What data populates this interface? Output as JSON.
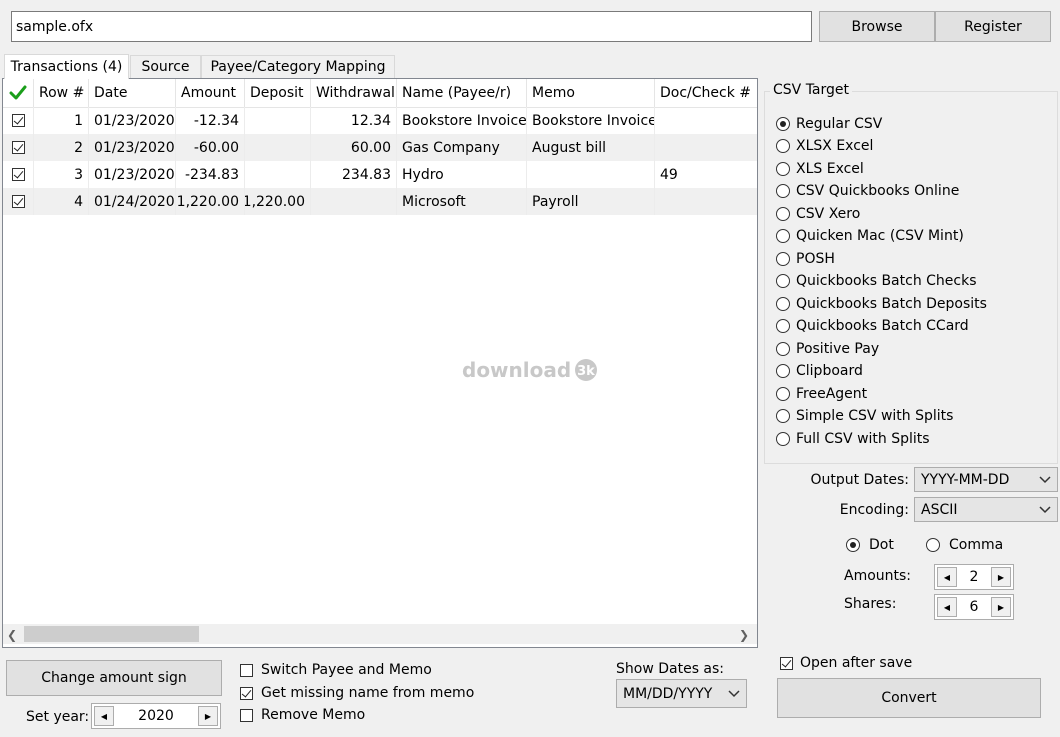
{
  "file": {
    "path": "sample.ofx"
  },
  "buttons": {
    "browse": "Browse",
    "register": "Register",
    "change_sign": "Change amount sign",
    "convert": "Convert"
  },
  "tabs": [
    {
      "label": "Transactions (4)",
      "active": true
    },
    {
      "label": "Source",
      "active": false
    },
    {
      "label": "Payee/Category Mapping",
      "active": false
    }
  ],
  "grid": {
    "headers": [
      "Row #",
      "Date",
      "Amount",
      "Deposit",
      "Withdrawal",
      "Name (Payee/r)",
      "Memo",
      "Doc/Check #"
    ],
    "rows": [
      {
        "checked": true,
        "row": "1",
        "date": "01/23/2020",
        "amount": "-12.34",
        "deposit": "",
        "withdrawal": "12.34",
        "name": "Bookstore Invoice",
        "memo": "Bookstore Invoice",
        "doc": ""
      },
      {
        "checked": true,
        "row": "2",
        "date": "01/23/2020",
        "amount": "-60.00",
        "deposit": "",
        "withdrawal": "60.00",
        "name": "Gas Company",
        "memo": "August bill",
        "doc": ""
      },
      {
        "checked": true,
        "row": "3",
        "date": "01/23/2020",
        "amount": "-234.83",
        "deposit": "",
        "withdrawal": "234.83",
        "name": "Hydro",
        "memo": "",
        "doc": "49"
      },
      {
        "checked": true,
        "row": "4",
        "date": "01/24/2020",
        "amount": "1,220.00",
        "deposit": "1,220.00",
        "withdrawal": "",
        "name": "Microsoft",
        "memo": "Payroll",
        "doc": ""
      }
    ],
    "watermark": "download"
  },
  "csv_target": {
    "legend": "CSV Target",
    "selected": 0,
    "options": [
      "Regular CSV",
      "XLSX Excel",
      "XLS Excel",
      "CSV Quickbooks Online",
      "CSV Xero",
      "Quicken Mac (CSV Mint)",
      "POSH",
      "Quickbooks Batch Checks",
      "Quickbooks Batch Deposits",
      "Quickbooks Batch CCard",
      "Positive Pay",
      "Clipboard",
      "FreeAgent",
      "Simple CSV with Splits",
      "Full CSV with Splits"
    ]
  },
  "output": {
    "dates_label": "Output Dates:",
    "dates_value": "YYYY-MM-DD",
    "encoding_label": "Encoding:",
    "encoding_value": "ASCII",
    "dot_label": "Dot",
    "comma_label": "Comma",
    "decimal": "dot",
    "amounts_label": "Amounts:",
    "amounts_value": "2",
    "shares_label": "Shares:",
    "shares_value": "6",
    "open_after_save": "Open after save",
    "open_after_save_checked": true
  },
  "bottom": {
    "set_year_label": "Set year:",
    "year": "2020",
    "switch_payee": "Switch Payee and Memo",
    "switch_payee_checked": false,
    "get_missing": "Get missing name from memo",
    "get_missing_checked": true,
    "remove_memo": "Remove Memo",
    "remove_memo_checked": false,
    "show_dates_label": "Show Dates as:",
    "show_dates_value": "MM/DD/YYYY"
  },
  "colors": {
    "check_green": "#1a9e1a",
    "selected_row": "#f0f0f0",
    "button_bg": "#e1e1e1"
  }
}
